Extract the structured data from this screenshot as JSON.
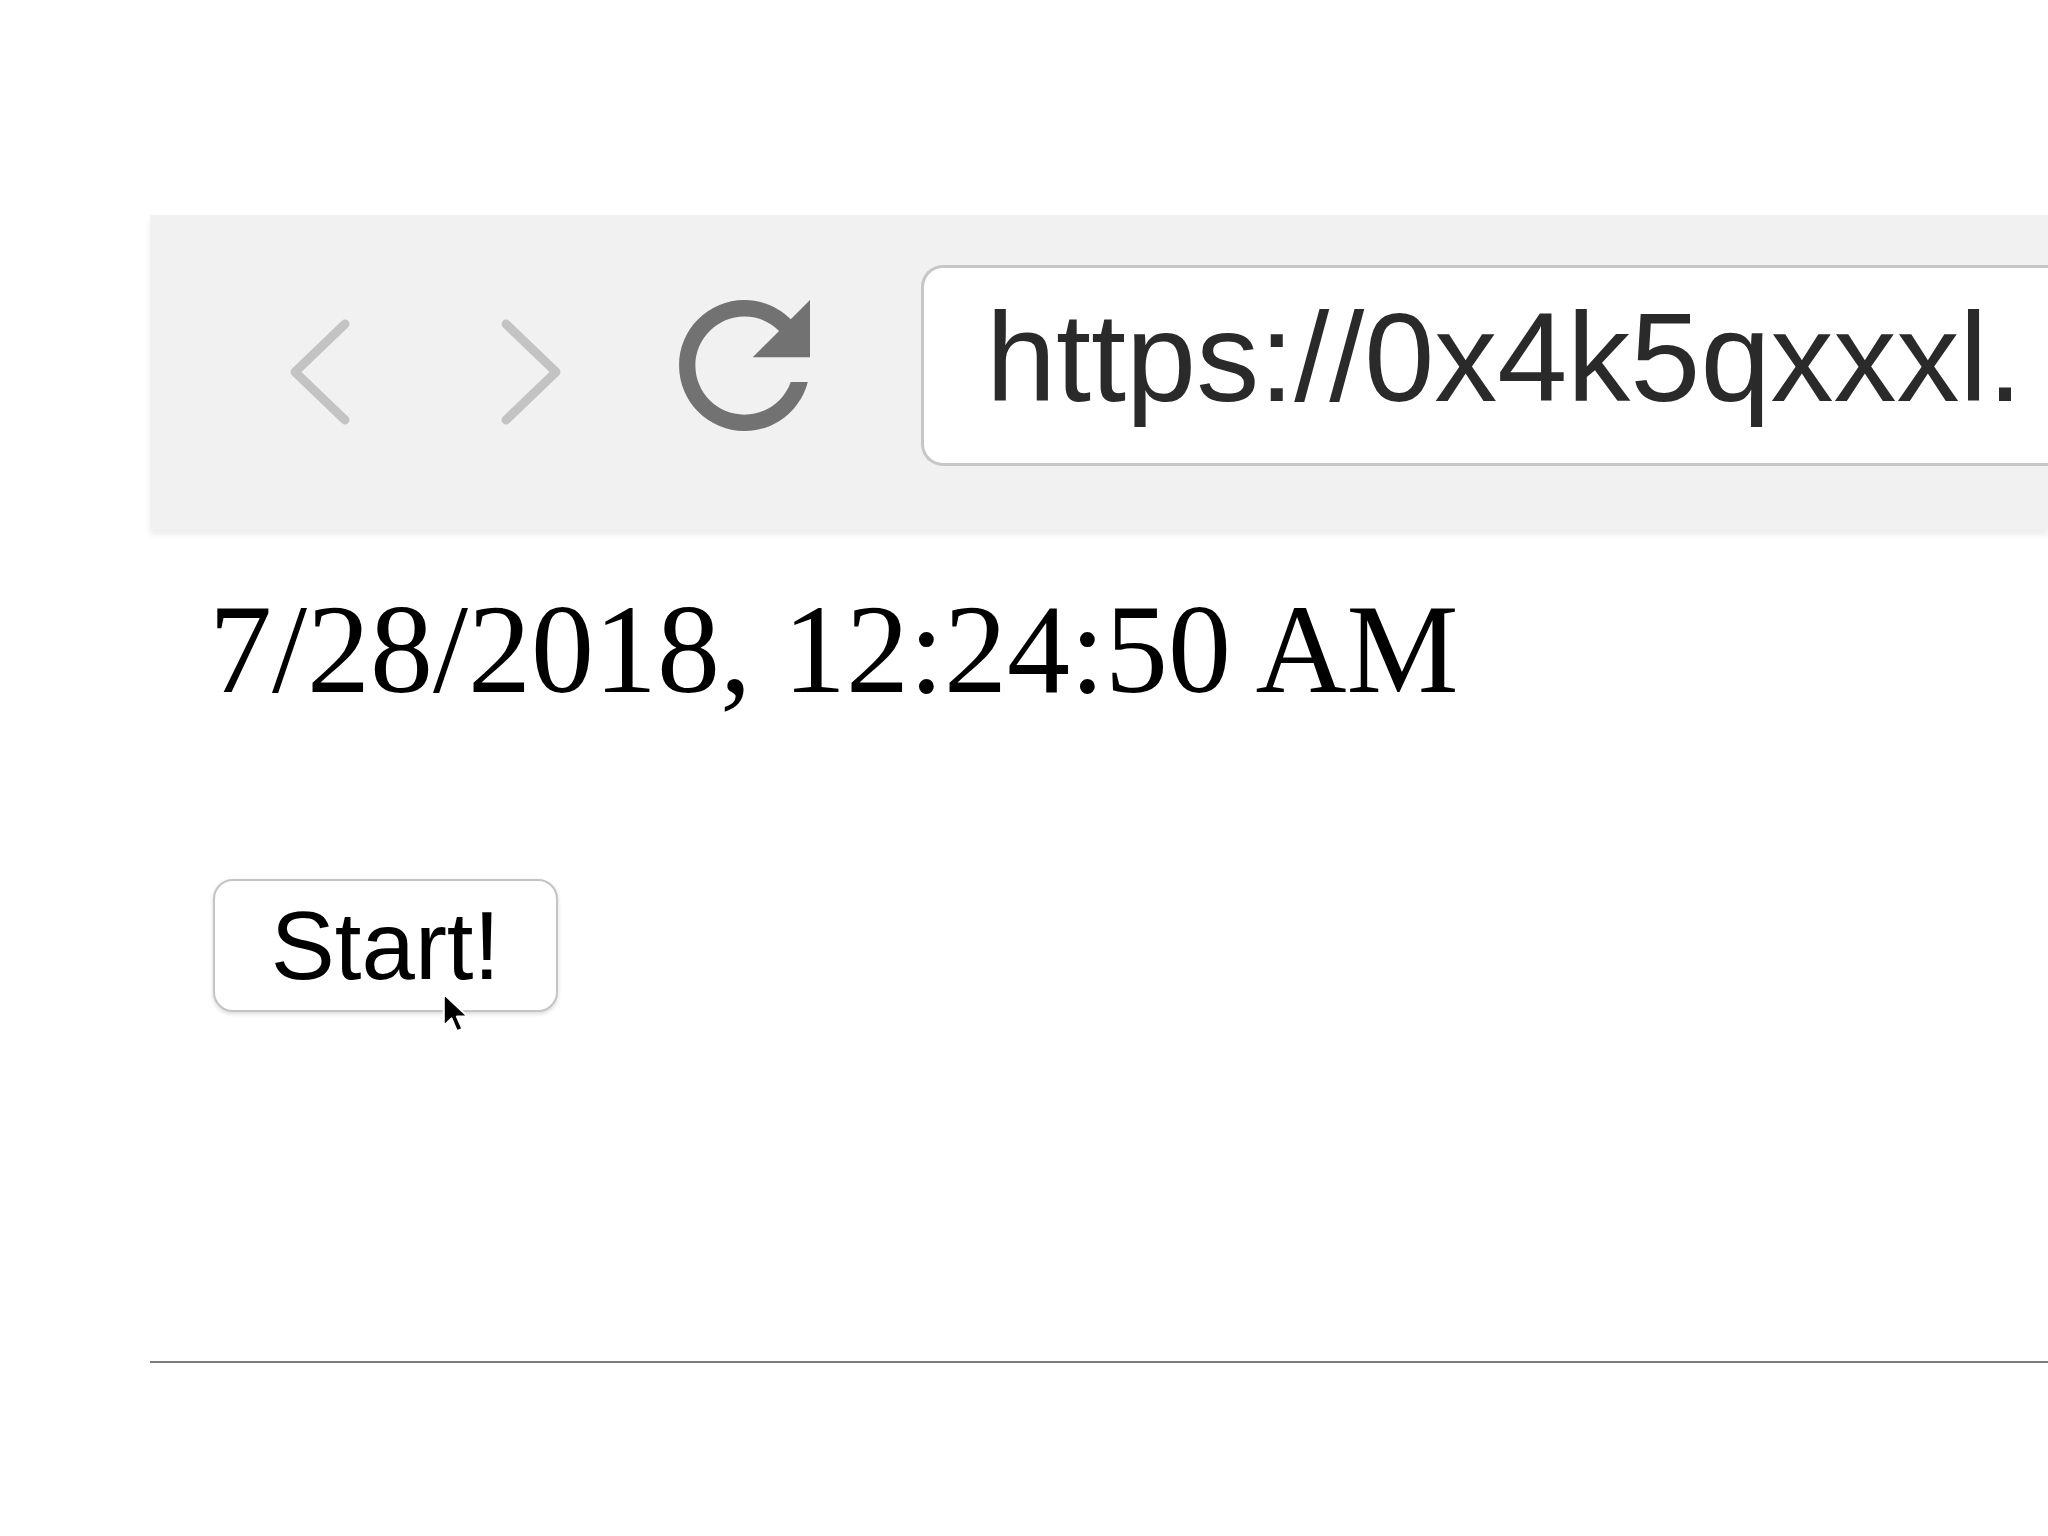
{
  "toolbar": {
    "nav_buttons": [
      {
        "kind": "back",
        "disabled": true
      },
      {
        "kind": "forward",
        "disabled": true
      }
    ],
    "address_field": {
      "value": "https://0x4k5qxxxl."
    }
  },
  "date_time": "7/28/2018, 12:24:50 AM",
  "start_button": {
    "label": "Start!"
  }
}
